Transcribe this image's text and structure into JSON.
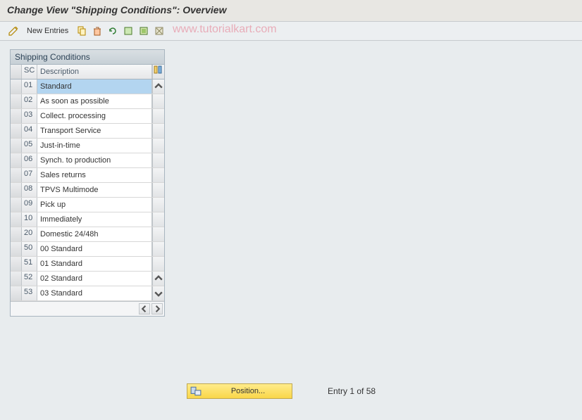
{
  "header": {
    "title": "Change View \"Shipping Conditions\": Overview"
  },
  "toolbar": {
    "new_entries_label": "New Entries"
  },
  "watermark": "www.tutorialkart.com",
  "panel": {
    "title": "Shipping Conditions",
    "columns": {
      "sc": "SC",
      "description": "Description"
    },
    "rows": [
      {
        "sc": "01",
        "desc": "Standard",
        "highlight": true
      },
      {
        "sc": "02",
        "desc": "As soon as possible"
      },
      {
        "sc": "03",
        "desc": "Collect. processing"
      },
      {
        "sc": "04",
        "desc": "Transport Service"
      },
      {
        "sc": "05",
        "desc": "Just-in-time"
      },
      {
        "sc": "06",
        "desc": "Synch. to production"
      },
      {
        "sc": "07",
        "desc": "Sales returns"
      },
      {
        "sc": "08",
        "desc": "TPVS Multimode"
      },
      {
        "sc": "09",
        "desc": "Pick up"
      },
      {
        "sc": "10",
        "desc": "Immediately"
      },
      {
        "sc": "20",
        "desc": "Domestic 24/48h"
      },
      {
        "sc": "50",
        "desc": "00 Standard"
      },
      {
        "sc": "51",
        "desc": "01 Standard"
      },
      {
        "sc": "52",
        "desc": "02 Standard"
      },
      {
        "sc": "53",
        "desc": "03 Standard"
      }
    ]
  },
  "position_button_label": "Position...",
  "entry_status": "Entry 1 of 58"
}
